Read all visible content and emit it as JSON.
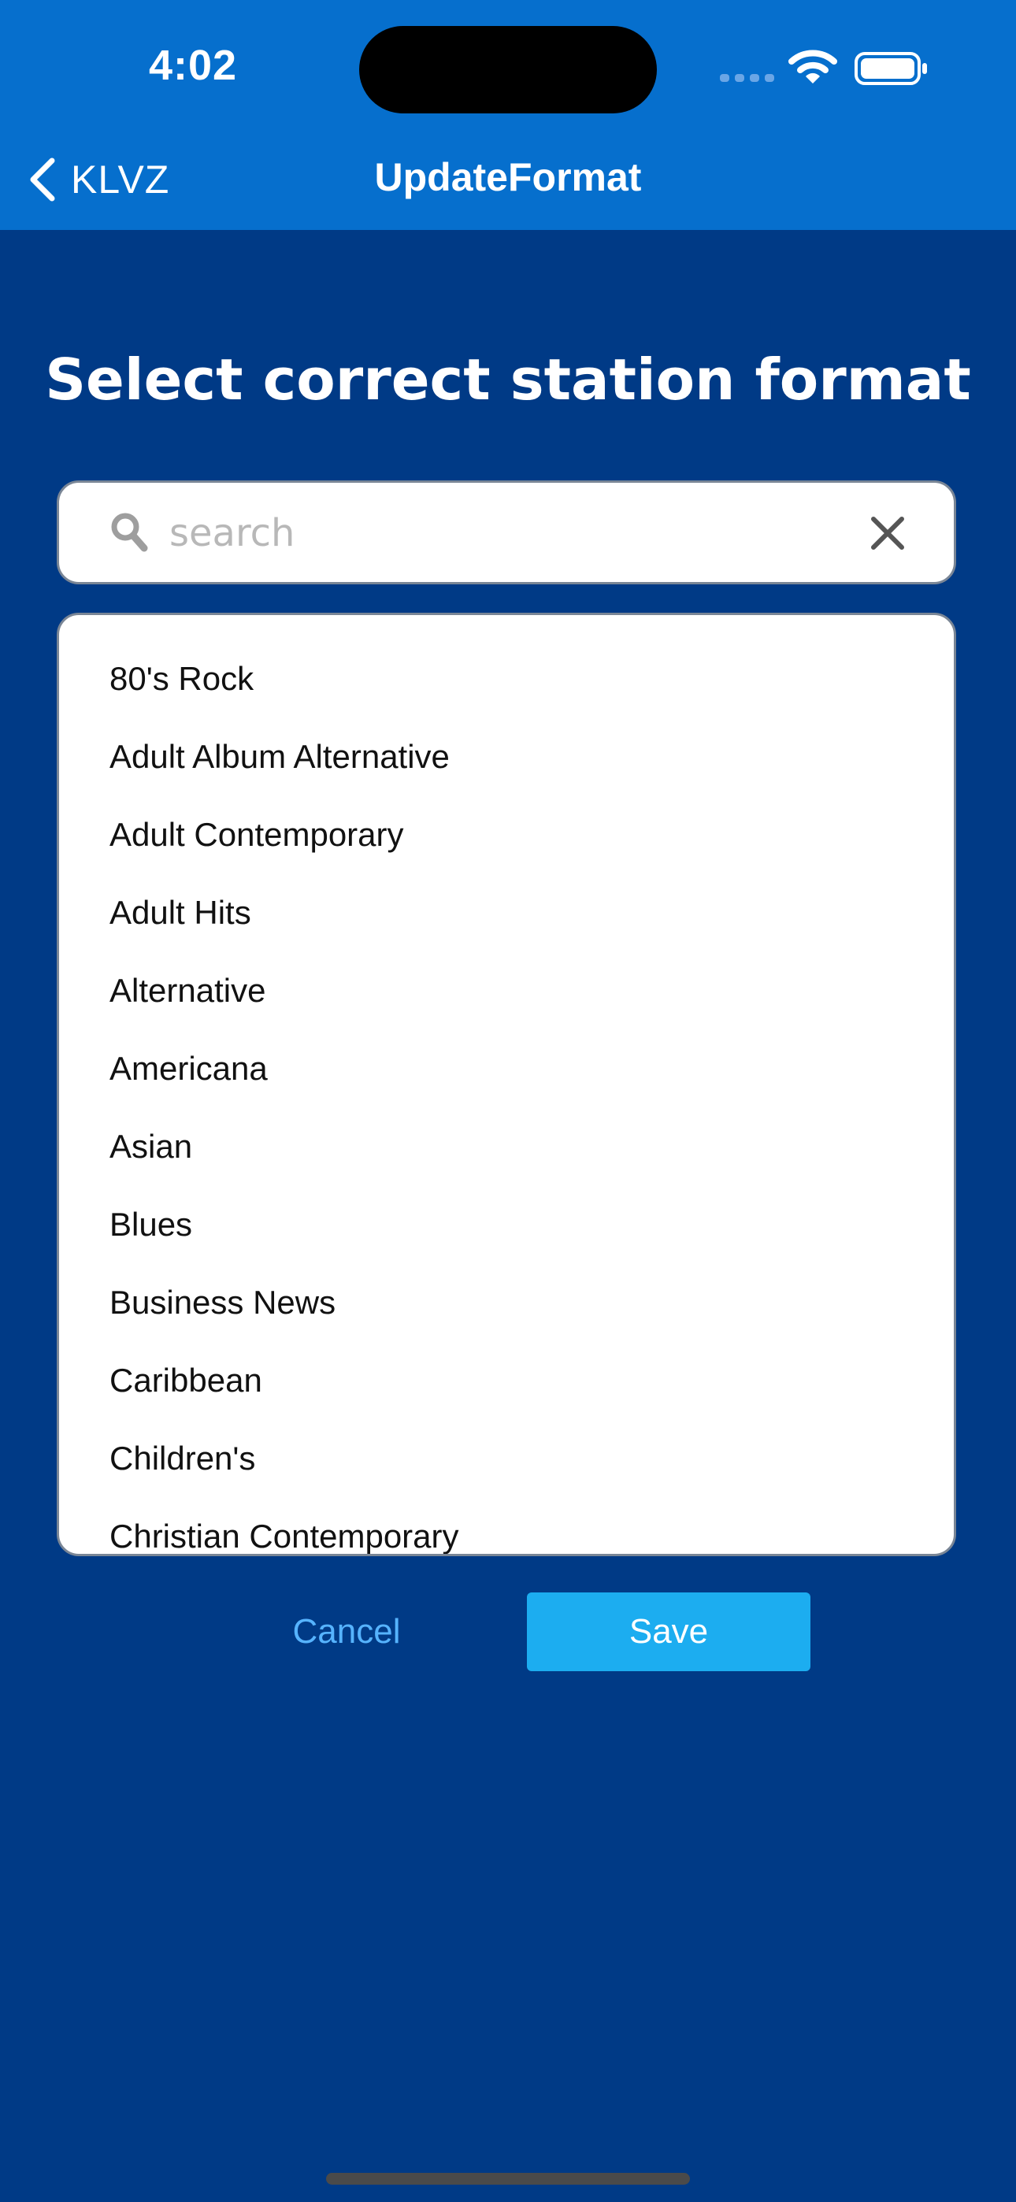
{
  "status_bar": {
    "time": "4:02",
    "icons": [
      "cellular-signal-icon",
      "wifi-icon",
      "battery-icon"
    ]
  },
  "nav": {
    "back_label": "KLVZ",
    "back_icon": "chevron-left-icon",
    "title": "UpdateFormat"
  },
  "main": {
    "heading": "Select correct station format"
  },
  "search": {
    "placeholder": "search",
    "value": "",
    "icon": "search-icon",
    "clear_icon": "close-icon"
  },
  "formats": [
    "80's Rock",
    "Adult Album Alternative",
    "Adult Contemporary",
    "Adult Hits",
    "Alternative",
    "Americana",
    "Asian",
    "Blues",
    "Business News",
    "Caribbean",
    "Children's",
    "Christian Contemporary"
  ],
  "actions": {
    "cancel_label": "Cancel",
    "save_label": "Save"
  },
  "colors": {
    "header": "#066fcd",
    "background": "#003a86",
    "save_button": "#1cadf0",
    "cancel_text": "#56b3ff"
  }
}
